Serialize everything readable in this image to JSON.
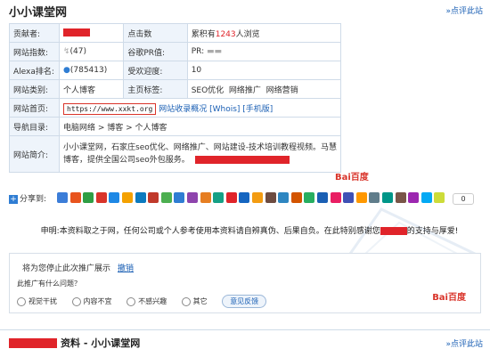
{
  "header": {
    "title": "小小课堂网",
    "more_link": "»点评此站"
  },
  "info": {
    "contributor_label": "贡献者:",
    "visits_label": "点击数",
    "visits_prefix": "累积有",
    "visits_count": "1243",
    "visits_suffix": "人浏览",
    "site_index_label": "网站指数:",
    "site_index_value": "(47)",
    "google_pr_label": "谷歌PR值:",
    "google_pr_value": "PR:",
    "alexa_label": "Alexa排名:",
    "alexa_value": "(785413)",
    "popularity_label": "受欢迎度:",
    "popularity_value": "10",
    "category_label": "网站类别:",
    "category_value": "个人博客",
    "tags_label": "主页标签:",
    "tags": [
      "SEO优化",
      "网络推广",
      "网络营销"
    ],
    "homepage_label": "网站首页:",
    "homepage_url": "https://www.xxkt.org",
    "homepage_links": [
      "网站收录概况",
      "[Whois]",
      "[手机版]"
    ],
    "nav_label": "导航目录:",
    "nav_path": "电脑网络 > 博客 > 个人博客",
    "intro_label": "网站简介:",
    "intro_line1": "小小课堂网，石家庄seo优化、网络推广、网站建设-技术培训教程视频。马慧",
    "intro_line2": "博客，提供全国公司seo外包服务。"
  },
  "share": {
    "label": "分享到:",
    "count": "0",
    "icon_colors": [
      "#3b7dd8",
      "#e8541e",
      "#2f9e44",
      "#d9342a",
      "#1e88e5",
      "#f4a100",
      "#0c7abf",
      "#c0392b",
      "#4caf50",
      "#2f7dd3",
      "#8e44ad",
      "#e67e22",
      "#16a085",
      "#e0242a",
      "#1565c0",
      "#f39c12",
      "#6d4c41",
      "#2e86c1",
      "#d35400",
      "#27ae60",
      "#1a5fb4",
      "#e91e63",
      "#3f51b5",
      "#ff9800",
      "#607d8b",
      "#009688",
      "#795548",
      "#9c27b0",
      "#03a9f4",
      "#cddc39"
    ]
  },
  "baidu_logo": "Bai百度",
  "statement": {
    "text_before": "申明:本资料取之于网，任何公司或个人参考使用本资料请自辨真伪、后果自负。在此特别感谢您",
    "text_after": "的支持与厚爱!"
  },
  "ad_feedback": {
    "question": "将为您停止此次推广展示",
    "undo_label": "撤销",
    "problem_label": "此推广有什么问题？",
    "options": [
      "视觉干扰",
      "内容不宜",
      "不感兴趣",
      "其它"
    ],
    "submit_label": "意见反馈",
    "brand": "Bai百度"
  },
  "footer": {
    "title": "资料 - 小小课堂网",
    "more_link": "»点评此站"
  }
}
